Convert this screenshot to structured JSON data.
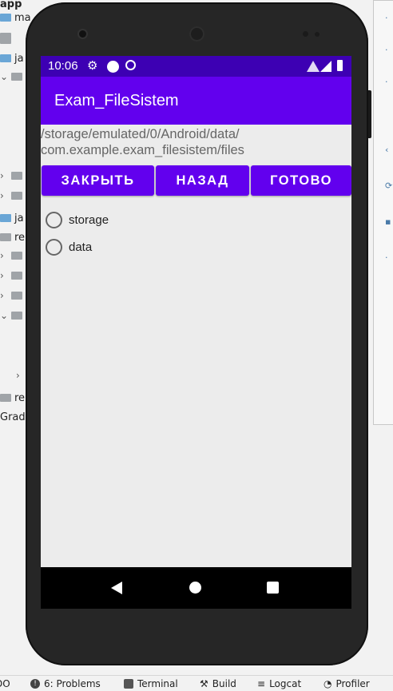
{
  "ide": {
    "tree_items": [
      {
        "label": "app"
      },
      {
        "label": "ma"
      },
      {
        "label": "ja"
      },
      {
        "label": "ja"
      },
      {
        "label": "re"
      },
      {
        "label": "re"
      },
      {
        "label": "Gradl"
      }
    ],
    "status_bar": {
      "todo": "DO",
      "problems": "6: Problems",
      "terminal": "Terminal",
      "build": "Build",
      "logcat": "Logcat",
      "profiler": "Profiler"
    }
  },
  "device": {
    "status_bar": {
      "time": "10:06"
    },
    "app_bar": {
      "title": "Exam_FileSistem"
    },
    "path": {
      "line1": "/storage/emulated/0/Android/data/",
      "line2": "com.example.exam_filesistem/files"
    },
    "buttons": {
      "close": "ЗАКРЫТЬ",
      "back": "НАЗАД",
      "done": "ГОТОВО"
    },
    "radio_items": [
      {
        "label": "storage",
        "checked": false
      },
      {
        "label": "data",
        "checked": false
      }
    ]
  },
  "colors": {
    "primary": "#6200ee",
    "primary_dark": "#3d00b3",
    "screen_bg": "#ececec"
  }
}
